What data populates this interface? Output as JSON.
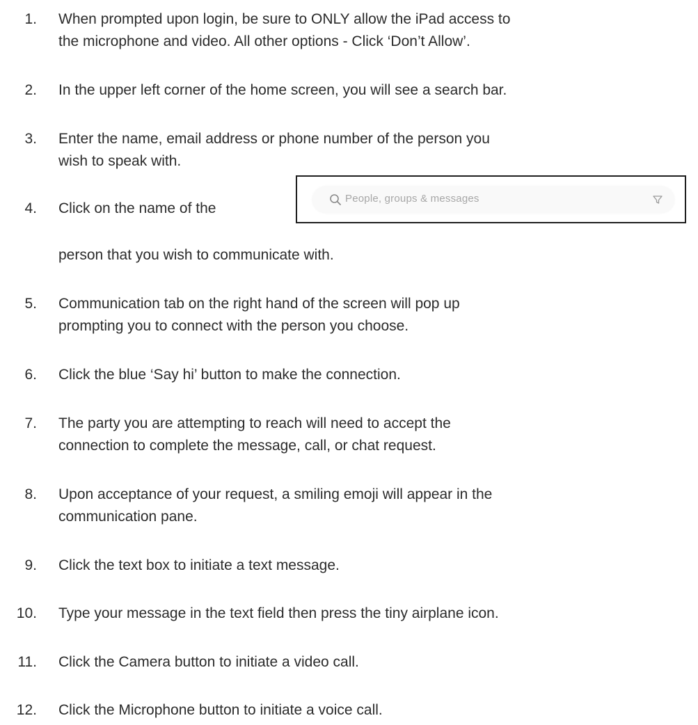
{
  "steps": [
    {
      "number": "1.",
      "lines": [
        "When prompted upon login, be sure to ONLY allow the iPad access to",
        "the microphone and video. All other options - Click ‘Don’t Allow’."
      ]
    },
    {
      "number": "2.",
      "lines": [
        "In the upper left corner of the home screen, you will see a search bar."
      ]
    },
    {
      "number": "3.",
      "lines": [
        "Enter the name, email address or phone number of the person you",
        "wish to speak with."
      ]
    },
    {
      "number": "4.",
      "lines": [
        "Click on the name of the",
        "person that you wish to communicate with."
      ]
    },
    {
      "number": "5.",
      "lines": [
        "Communication tab on the right hand of the screen will pop up",
        "prompting you to connect with the person you choose."
      ]
    },
    {
      "number": "6.",
      "lines": [
        "Click the blue ‘Say hi’ button to make the connection."
      ]
    },
    {
      "number": "7.",
      "lines": [
        "The party you are attempting to reach will need to accept the",
        "connection to complete the message, call, or chat request."
      ]
    },
    {
      "number": "8.",
      "lines": [
        "Upon acceptance of your request, a smiling emoji will appear in the",
        "communication pane."
      ]
    },
    {
      "number": "9.",
      "lines": [
        "Click the text box to initiate a text message."
      ]
    },
    {
      "number": "10.",
      "lines": [
        "Type your message in the text field then press the tiny airplane icon."
      ]
    },
    {
      "number": "11.",
      "lines": [
        "Click the Camera button to initiate a video call."
      ]
    },
    {
      "number": "12.",
      "lines": [
        "Click the Microphone button to initiate a voice call."
      ]
    }
  ],
  "search_screenshot": {
    "placeholder": "People, groups & messages",
    "search_icon": "search-icon",
    "filter_icon": "filter-icon"
  }
}
